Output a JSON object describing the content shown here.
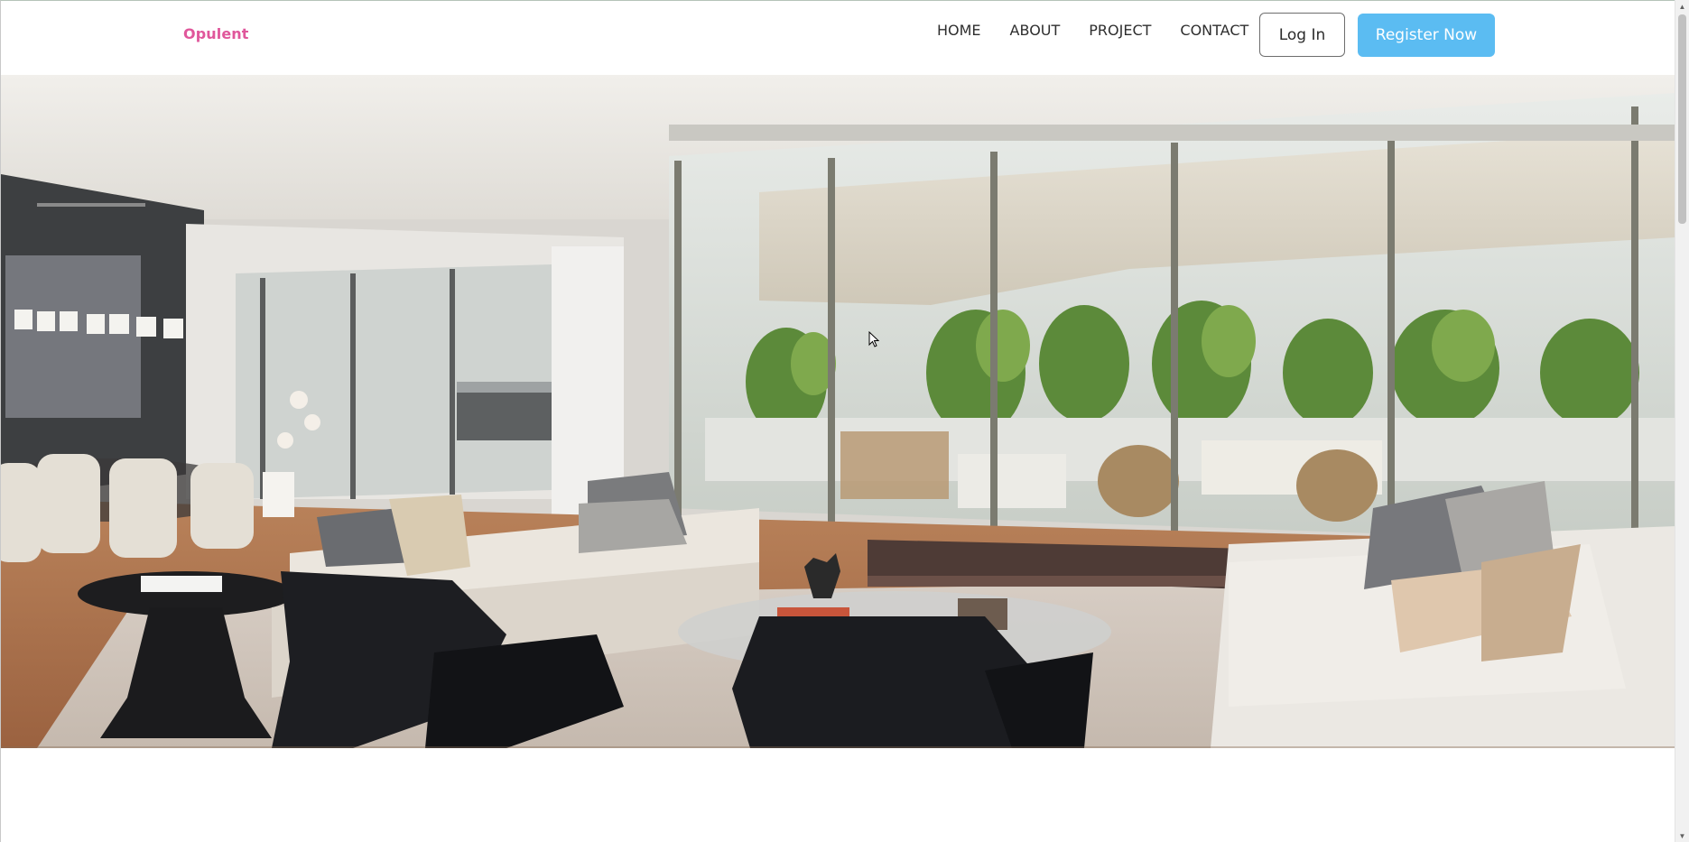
{
  "brand": {
    "name": "Opulent",
    "color": "#e0579b"
  },
  "nav": {
    "links": [
      {
        "label": "HOME"
      },
      {
        "label": "ABOUT"
      },
      {
        "label": "PROJECT"
      },
      {
        "label": "CONTACT"
      }
    ]
  },
  "auth": {
    "login_label": "Log In",
    "register_label": "Register Now",
    "register_color": "#5bbcf2"
  },
  "hero": {
    "image_name": "living-room-interior-photo"
  },
  "scrollbar": {
    "up_icon": "triangle-up-icon",
    "down_icon": "triangle-down-icon"
  }
}
